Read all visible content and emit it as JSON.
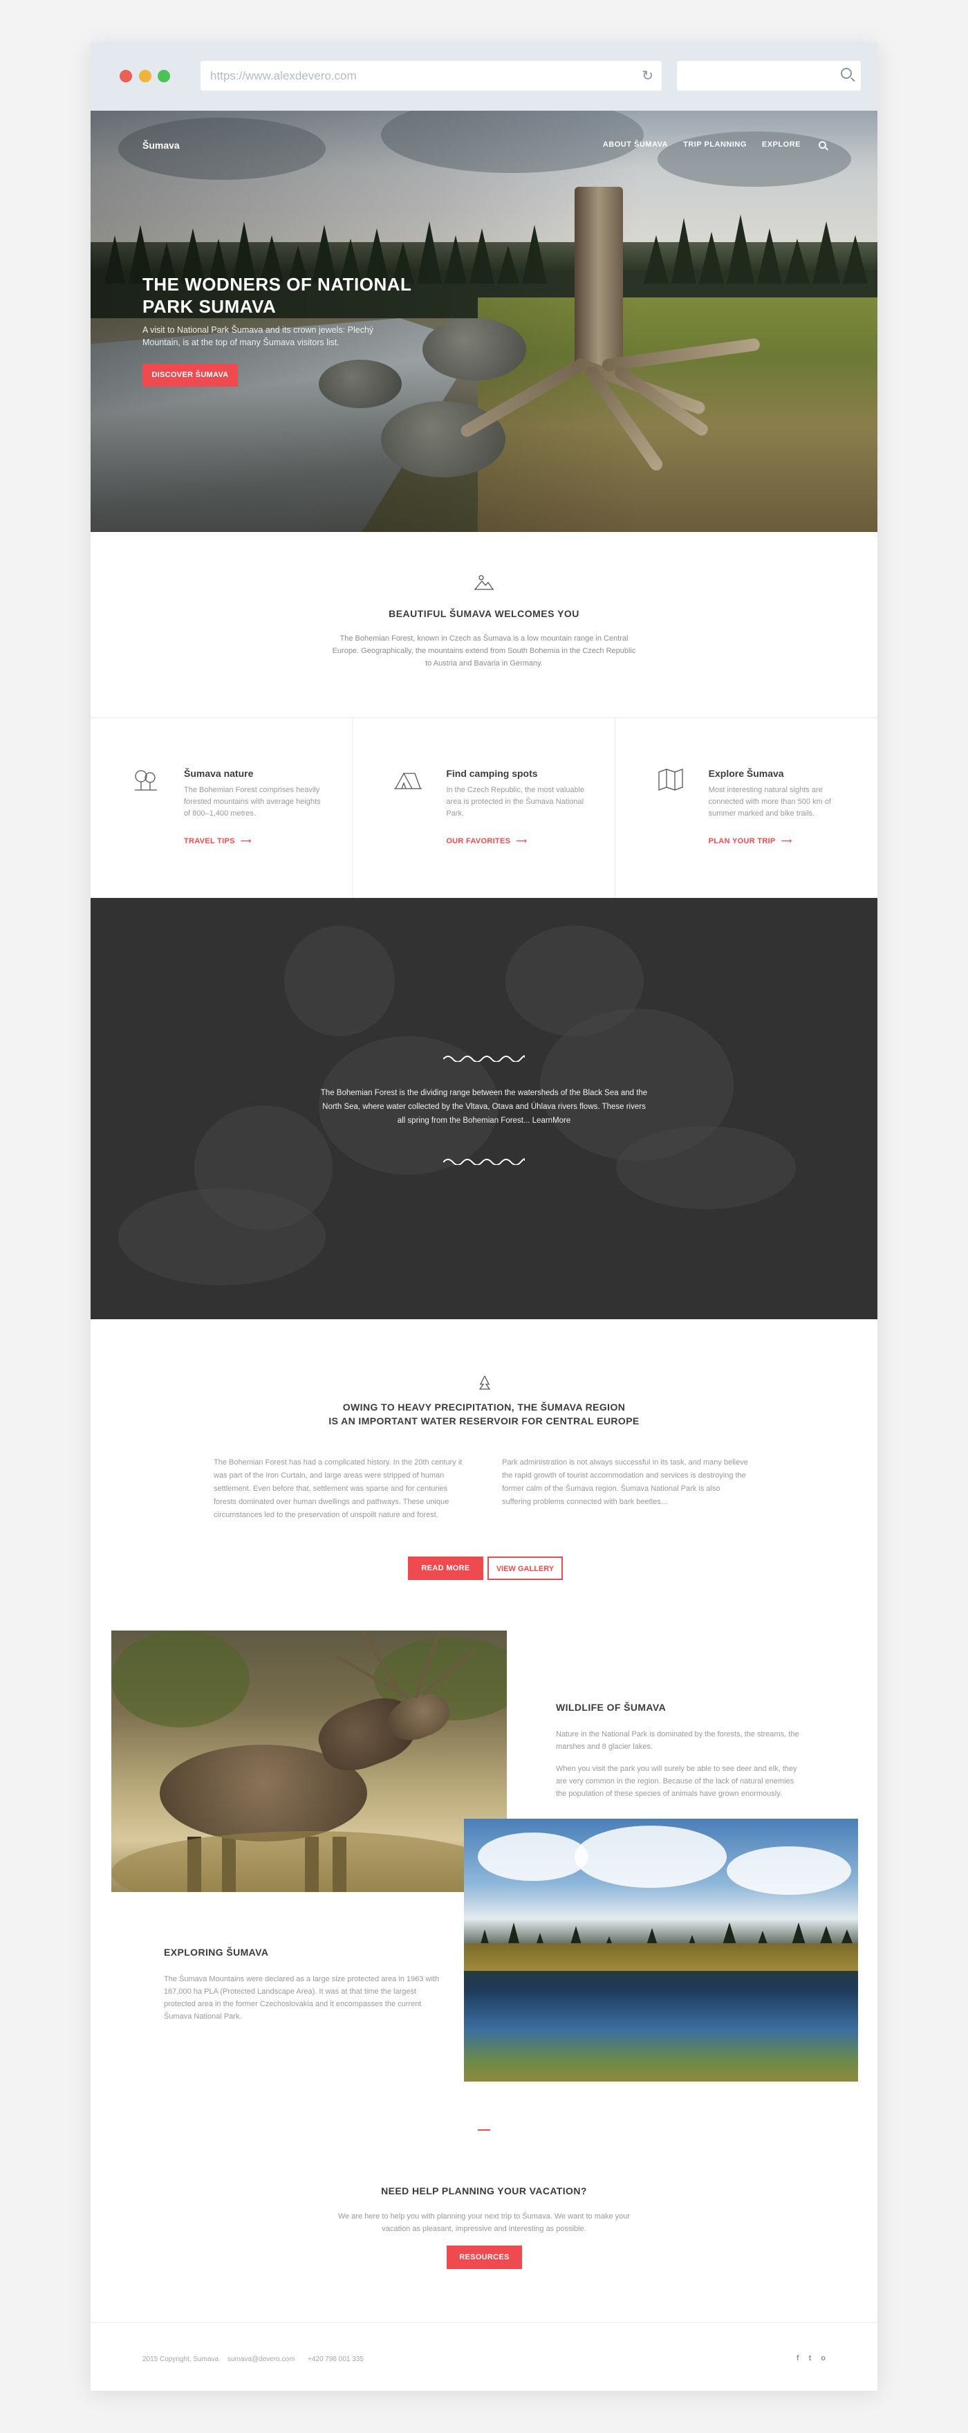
{
  "browser": {
    "url": "https://www.alexdevero.com",
    "window_controls": [
      "close",
      "minimize",
      "maximize"
    ],
    "search_placeholder": ""
  },
  "nav": {
    "logo": "Šumava",
    "items": [
      "ABOUT ŠUMAVA",
      "TRIP PLANNING",
      "EXPLORE"
    ],
    "search_icon": "search-icon"
  },
  "hero": {
    "title": "THE WODNERS OF NATIONAL PARK SUMAVA",
    "text": "A visit to National Park Šumava and its crown jewels: Plechý Mountain, is at the top of many Šumava visitors list.",
    "button": "DISCOVER ŠUMAVA"
  },
  "welcome": {
    "icon": "mountain-icon",
    "title": "BEAUTIFUL ŠUMAVA WELCOMES YOU",
    "text": "The Bohemian Forest, known in Czech as Šumava is a low mountain range in Central Europe. Geographically, the mountains extend from South Bohemia in the Czech Republic to Austria and Bavaria in Germany."
  },
  "features": [
    {
      "icon": "tree-icon",
      "title": "Šumava nature",
      "text": "The Bohemian Forest comprises heavily forested mountains with average heights of 800–1,400 metres.",
      "link": "TRAVEL TIPS"
    },
    {
      "icon": "tent-icon",
      "title": "Find camping spots",
      "text": "In the Czech Republic, the most valuable area is protected in the Šumava National Park.",
      "link": "OUR FAVORITES"
    },
    {
      "icon": "map-icon",
      "title": "Explore Šumava",
      "text": "Most interesting natural sights are connected with more than 500 km of summer marked and bike trails.",
      "link": "PLAN YOUR TRIP"
    }
  ],
  "rafting": {
    "text": "The Bohemian Forest is the dividing range between the watersheds of the Black Sea and the North Sea, where water collected by the Vltava, Otava and Úhlava rivers flows. These rivers all spring from the Bohemian Forest... LearnMore"
  },
  "water": {
    "icon": "pine-icon",
    "title_line1": "OWING TO HEAVY PRECIPITATION, THE ŠUMAVA REGION",
    "title_line2": "IS AN IMPORTANT WATER RESERVOIR FOR CENTRAL EUROPE",
    "col_left": "The Bohemian Forest has had a complicated history. In the 20th century it was part of the Iron Curtain, and large areas were stripped of human settlement. Even before that, settlement was sparse and for centuries forests dominated over human dwellings and pathways. These unique circumstances led to the preservation of unspoilt nature and forest.",
    "col_right": "Park administration is not always successful in its task, and many believe the rapid growth of tourist accommodation and services is destroying the former calm of the Šumava region. Šumava National Park is also suffering problems connected with bark beetles...",
    "read_more": "READ MORE",
    "view_gallery": "VIEW GALLERY"
  },
  "wildlife": {
    "title": "WILDLIFE OF ŠUMAVA",
    "p1": "Nature in the National Park is dominated by the forests, the streams, the marshes and 8 glacier lakes.",
    "p2": "When you visit the park you will surely be able to see deer and elk, they are very common in the region. Because of the lack of natural enemies the population of these species of animals have grown enormously."
  },
  "exploring": {
    "title": "EXPLORING ŠUMAVA",
    "text": "The Šumava Mountains were declared as a large size protected area in 1963 with 167,000 ha PLA (Protected Landscape Area). It was at that time the largest protected area in the former Czechoslovakia and it encompasses the current Šumava National Park."
  },
  "help": {
    "title": "NEED HELP PLANNING YOUR VACATION?",
    "text": "We are here to help you with planning your next trip to Šumava. We want to make your vacation as pleasant, impressive and interesting as possible.",
    "button": "RESOURCES"
  },
  "footer": {
    "copyright": "2015 Copyright, Sumava",
    "email": "sumava@devero.com",
    "phone": "+420 798 001 335",
    "social": [
      "f",
      "t",
      "o"
    ]
  },
  "colors": {
    "accent": "#ef4a4f",
    "chrome": "#e3e9ee"
  }
}
